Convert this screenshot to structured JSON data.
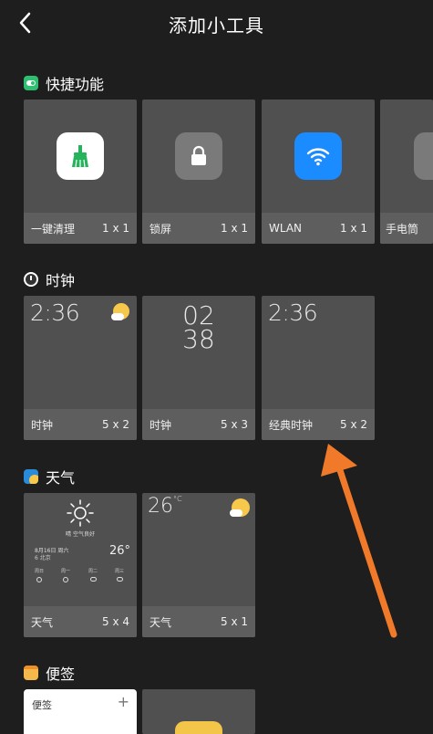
{
  "header": {
    "title": "添加小工具"
  },
  "sections": {
    "quick": {
      "title": "快捷功能"
    },
    "clock": {
      "title": "时钟"
    },
    "weather": {
      "title": "天气"
    },
    "notes": {
      "title": "便签"
    }
  },
  "quick_cards": [
    {
      "label": "一键清理",
      "size": "1 x 1",
      "icon": "broom-icon"
    },
    {
      "label": "锁屏",
      "size": "1 x 1",
      "icon": "lock-icon"
    },
    {
      "label": "WLAN",
      "size": "1 x 1",
      "icon": "wifi-icon"
    },
    {
      "label": "手电筒",
      "size": "",
      "icon": "flashlight-icon"
    }
  ],
  "clock_cards": [
    {
      "label": "时钟",
      "size": "5 x 2",
      "time": "2:36"
    },
    {
      "label": "时钟",
      "size": "5 x 3",
      "hour": "02",
      "minute": "38"
    },
    {
      "label": "经典时钟",
      "size": "5 x 2",
      "time": "2:36"
    }
  ],
  "weather_cards": [
    {
      "label": "天气",
      "size": "5 x 4",
      "temp": "26°",
      "desc": "晴 空气良好",
      "date": "8月16日 周六",
      "sub": "6 北京",
      "days": [
        "周日",
        "周一",
        "周二",
        "周三"
      ]
    },
    {
      "label": "天气",
      "size": "5 x 1",
      "temp": "26",
      "unit": "°C"
    }
  ],
  "note_card": {
    "label": "便签",
    "add": "+"
  },
  "colors": {
    "background": "#1e1e1e",
    "card": "#505050",
    "footer": "#5e5e5e",
    "arrow": "#f07a2a",
    "wifi": "#1a8cff"
  }
}
